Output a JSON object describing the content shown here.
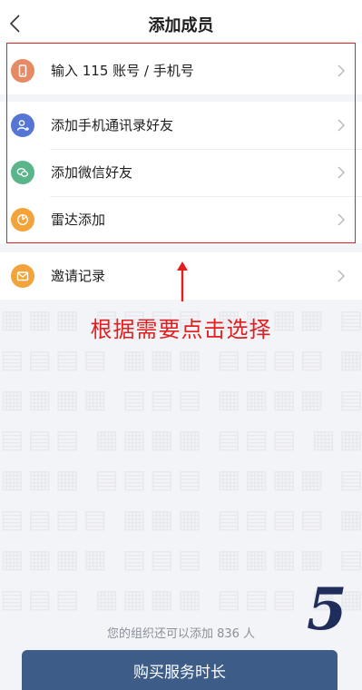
{
  "header": {
    "title": "添加成员",
    "back_icon": "chevron-left-icon"
  },
  "add_options": [
    {
      "label": "输入 115 账号 / 手机号",
      "icon": "phone-icon",
      "color": "#e58a63"
    },
    {
      "label": "添加手机通讯录好友",
      "icon": "contact-add-icon",
      "color": "#5676d6"
    },
    {
      "label": "添加微信好友",
      "icon": "wechat-icon",
      "color": "#5bb58a"
    },
    {
      "label": "雷达添加",
      "icon": "radar-icon",
      "color": "#f2a43a"
    }
  ],
  "invite": {
    "label": "邀请记录",
    "icon": "mail-icon",
    "color": "#f2a43a"
  },
  "annotation": {
    "text": "根据需要点击选择",
    "color": "#e02020"
  },
  "footer": {
    "remaining_text": "您的组织还可以添加 836 人",
    "buy_button_label": "购买服务时长",
    "buy_button_color": "#3d5c87"
  },
  "overlay": {
    "step_number": "5"
  }
}
